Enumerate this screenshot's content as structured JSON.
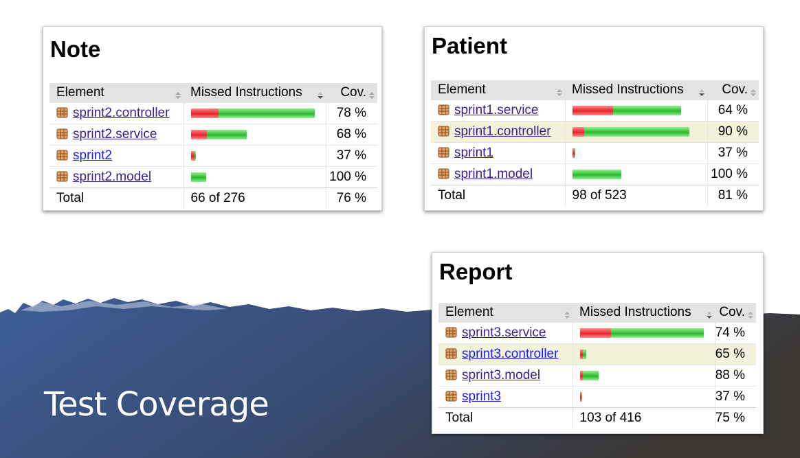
{
  "slide": {
    "title": "Test Coverage"
  },
  "colors": {
    "band_left": "#3d5e96",
    "band_right": "#3a3634",
    "missed_red": "#e8232a",
    "covered_green": "#2cb82c",
    "highlight_row": "#f2f2da"
  },
  "headers": {
    "element": "Element",
    "missed": "Missed Instructions",
    "cov": "Cov."
  },
  "panels": [
    {
      "title": "Note",
      "rows": [
        {
          "name": "sprint2.controller",
          "missed_fraction": 0.22,
          "total_fraction": 1.0,
          "cov": "78 %",
          "highlight": false,
          "visited": true
        },
        {
          "name": "sprint2.service",
          "missed_fraction": 0.13,
          "total_fraction": 0.45,
          "cov": "68 %",
          "highlight": false,
          "visited": true
        },
        {
          "name": "sprint2",
          "missed_fraction": 0.025,
          "total_fraction": 0.04,
          "cov": "37 %",
          "highlight": false,
          "visited": false
        },
        {
          "name": "sprint2.model",
          "missed_fraction": 0.0,
          "total_fraction": 0.12,
          "cov": "100 %",
          "highlight": false,
          "visited": true
        }
      ],
      "total": {
        "label": "Total",
        "missed": "66 of 276",
        "cov": "76 %"
      }
    },
    {
      "title": "Patient",
      "rows": [
        {
          "name": "sprint1.service",
          "missed_fraction": 0.35,
          "total_fraction": 0.93,
          "cov": "64 %",
          "highlight": false,
          "visited": true
        },
        {
          "name": "sprint1.controller",
          "missed_fraction": 0.1,
          "total_fraction": 1.0,
          "cov": "90 %",
          "highlight": true,
          "visited": true
        },
        {
          "name": "sprint1",
          "missed_fraction": 0.015,
          "total_fraction": 0.025,
          "cov": "37 %",
          "highlight": false,
          "visited": true
        },
        {
          "name": "sprint1.model",
          "missed_fraction": 0.0,
          "total_fraction": 0.42,
          "cov": "100 %",
          "highlight": false,
          "visited": true
        }
      ],
      "total": {
        "label": "Total",
        "missed": "98 of 523",
        "cov": "81 %"
      }
    },
    {
      "title": "Report",
      "rows": [
        {
          "name": "sprint3.service",
          "missed_fraction": 0.25,
          "total_fraction": 1.0,
          "cov": "74 %",
          "highlight": false,
          "visited": true
        },
        {
          "name": "sprint3.controller",
          "missed_fraction": 0.02,
          "total_fraction": 0.05,
          "cov": "65 %",
          "highlight": true,
          "visited": false
        },
        {
          "name": "sprint3.model",
          "missed_fraction": 0.02,
          "total_fraction": 0.15,
          "cov": "88 %",
          "highlight": false,
          "visited": true
        },
        {
          "name": "sprint3",
          "missed_fraction": 0.01,
          "total_fraction": 0.015,
          "cov": "37 %",
          "highlight": false,
          "visited": false
        }
      ],
      "total": {
        "label": "Total",
        "missed": "103 of 416",
        "cov": "75 %"
      }
    }
  ]
}
